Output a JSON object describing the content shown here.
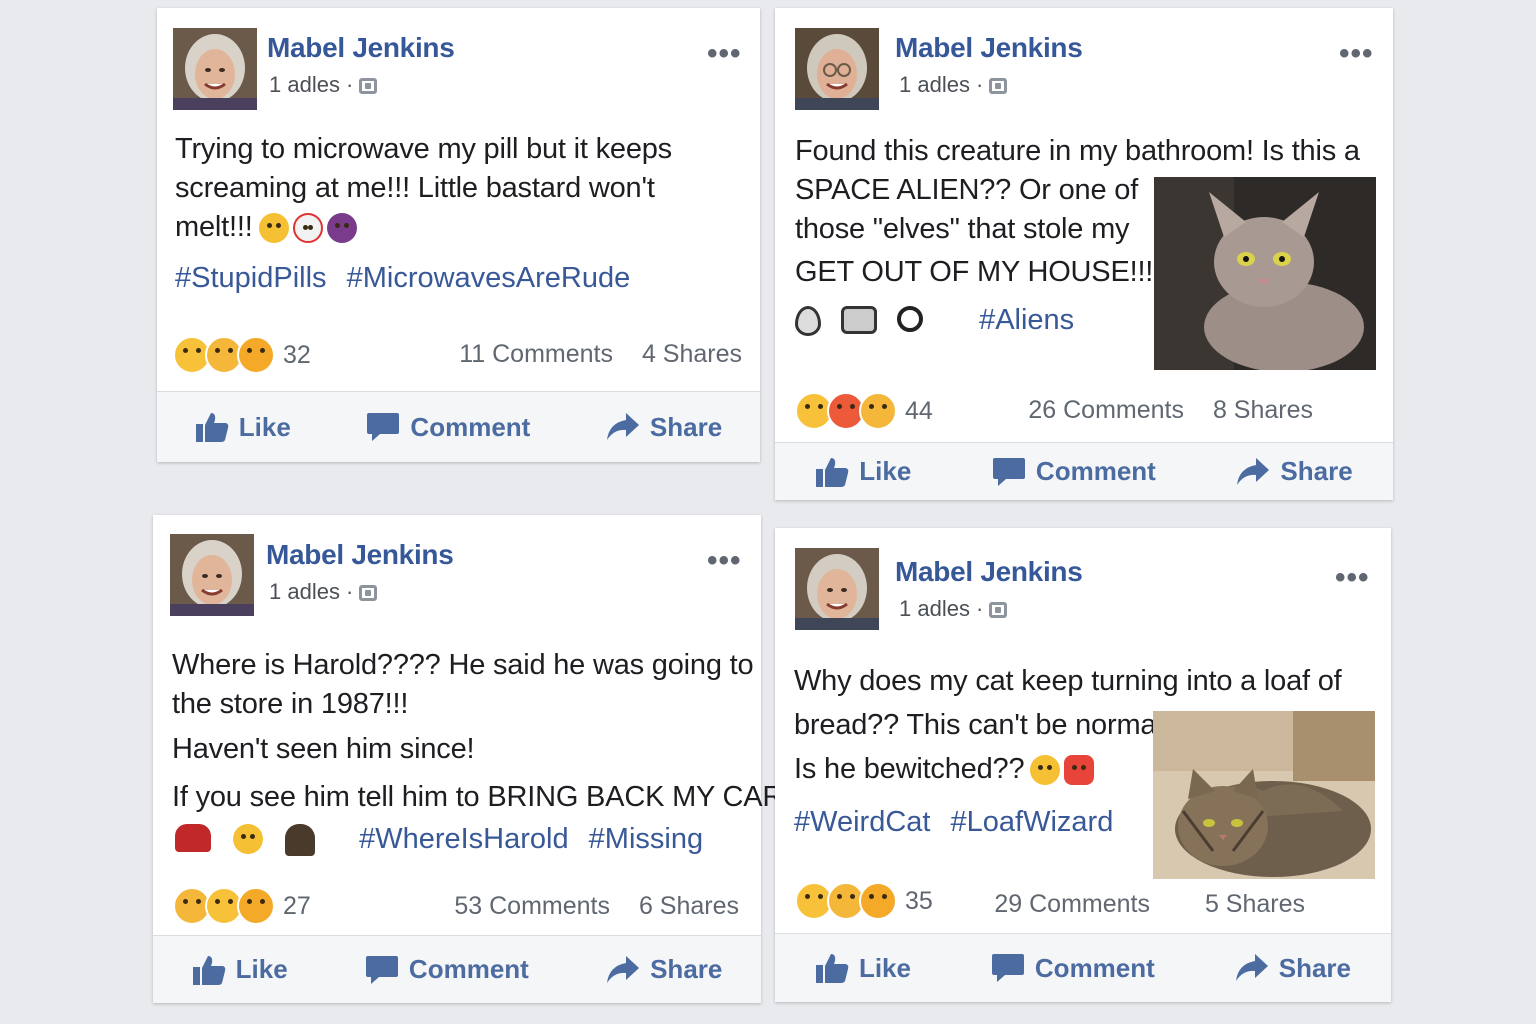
{
  "posts": [
    {
      "author": "Mabel Jenkins",
      "meta": "1 adles ·",
      "lines": [
        "Trying to microwave my pill but it keeps screaming at me!!! Little bastard won't melt!!!"
      ],
      "tags": [
        "#StupidPills",
        "#MicrowavesAreRude"
      ],
      "reaction_count": "32",
      "comments": "11 Comments",
      "shares": "4 Shares",
      "like": "Like",
      "comment": "Comment",
      "share": "Share"
    },
    {
      "author": "Mabel Jenkins",
      "meta": "1 adles ·",
      "lines": [
        "Found this creature in my bathroom! Is this a",
        "SPACE ALIEN?? Or one of",
        "those \"elves\" that stole my",
        "GET OUT OF MY HOUSE!!!"
      ],
      "tags": [
        "#Aliens"
      ],
      "reaction_count": "44",
      "comments": "26 Comments",
      "shares": "8 Shares",
      "like": "Like",
      "comment": "Comment",
      "share": "Share"
    },
    {
      "author": "Mabel Jenkins",
      "meta": "1 adles ·",
      "lines": [
        "Where is Harold???? He said he was going to the store in 1987!!!",
        "Haven't seen him since!",
        "If you see him tell him to BRING BACK MY CAR!!!"
      ],
      "tags": [
        "#WhereIsHarold",
        "#Missing"
      ],
      "reaction_count": "27",
      "comments": "53 Comments",
      "shares": "6 Shares",
      "like": "Like",
      "comment": "Comment",
      "share": "Share"
    },
    {
      "author": "Mabel Jenkins",
      "meta": "1 adles ·",
      "lines": [
        "Why does my cat keep turning into a loaf of",
        "bread?? This can't be normal.",
        "Is he bewitched??"
      ],
      "tags": [
        "#WeirdCat",
        "#LoafWizard"
      ],
      "reaction_count": "35",
      "comments": "29 Comments",
      "shares": "5 Shares",
      "like": "Like",
      "comment": "Comment",
      "share": "Share"
    }
  ],
  "colors": {
    "link_blue": "#365899",
    "hashtag_blue": "#385898",
    "action_blue": "#4b6ba1",
    "page_bg": "#e9eaee"
  },
  "icons": [
    "more-options-icon",
    "privacy-icon",
    "like-thumb-icon",
    "comment-bubble-icon",
    "share-arrow-icon"
  ]
}
